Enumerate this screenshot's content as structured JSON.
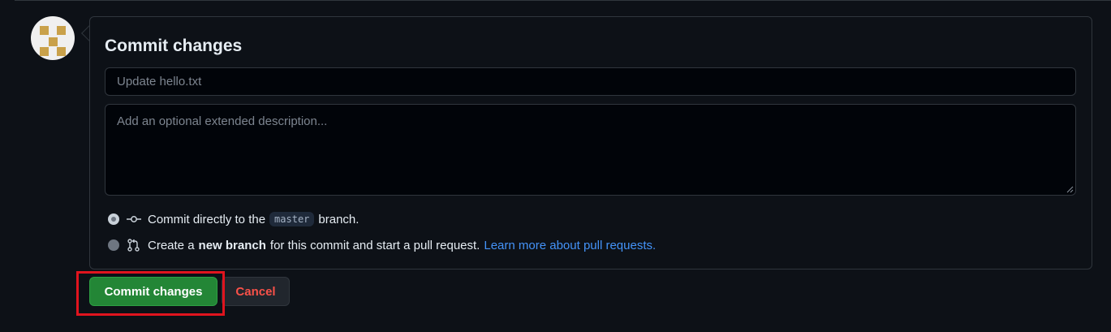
{
  "panel": {
    "title": "Commit changes",
    "summary_placeholder": "Update hello.txt",
    "description_placeholder": "Add an optional extended description..."
  },
  "options": [
    {
      "checked": true,
      "icon": "git-commit-icon",
      "text_before": "Commit directly to the",
      "branch": "master",
      "text_after": "branch."
    },
    {
      "checked": false,
      "icon": "git-pull-request-icon",
      "text_before": "Create a",
      "bold": "new branch",
      "text_after": "for this commit and start a pull request.",
      "link": "Learn more about pull requests."
    }
  ],
  "actions": {
    "commit_label": "Commit changes",
    "cancel_label": "Cancel"
  },
  "colors": {
    "background": "#0d1117",
    "primary_button": "#238636",
    "danger_text": "#f85149",
    "link": "#4493f8",
    "highlight": "#e0141e"
  }
}
